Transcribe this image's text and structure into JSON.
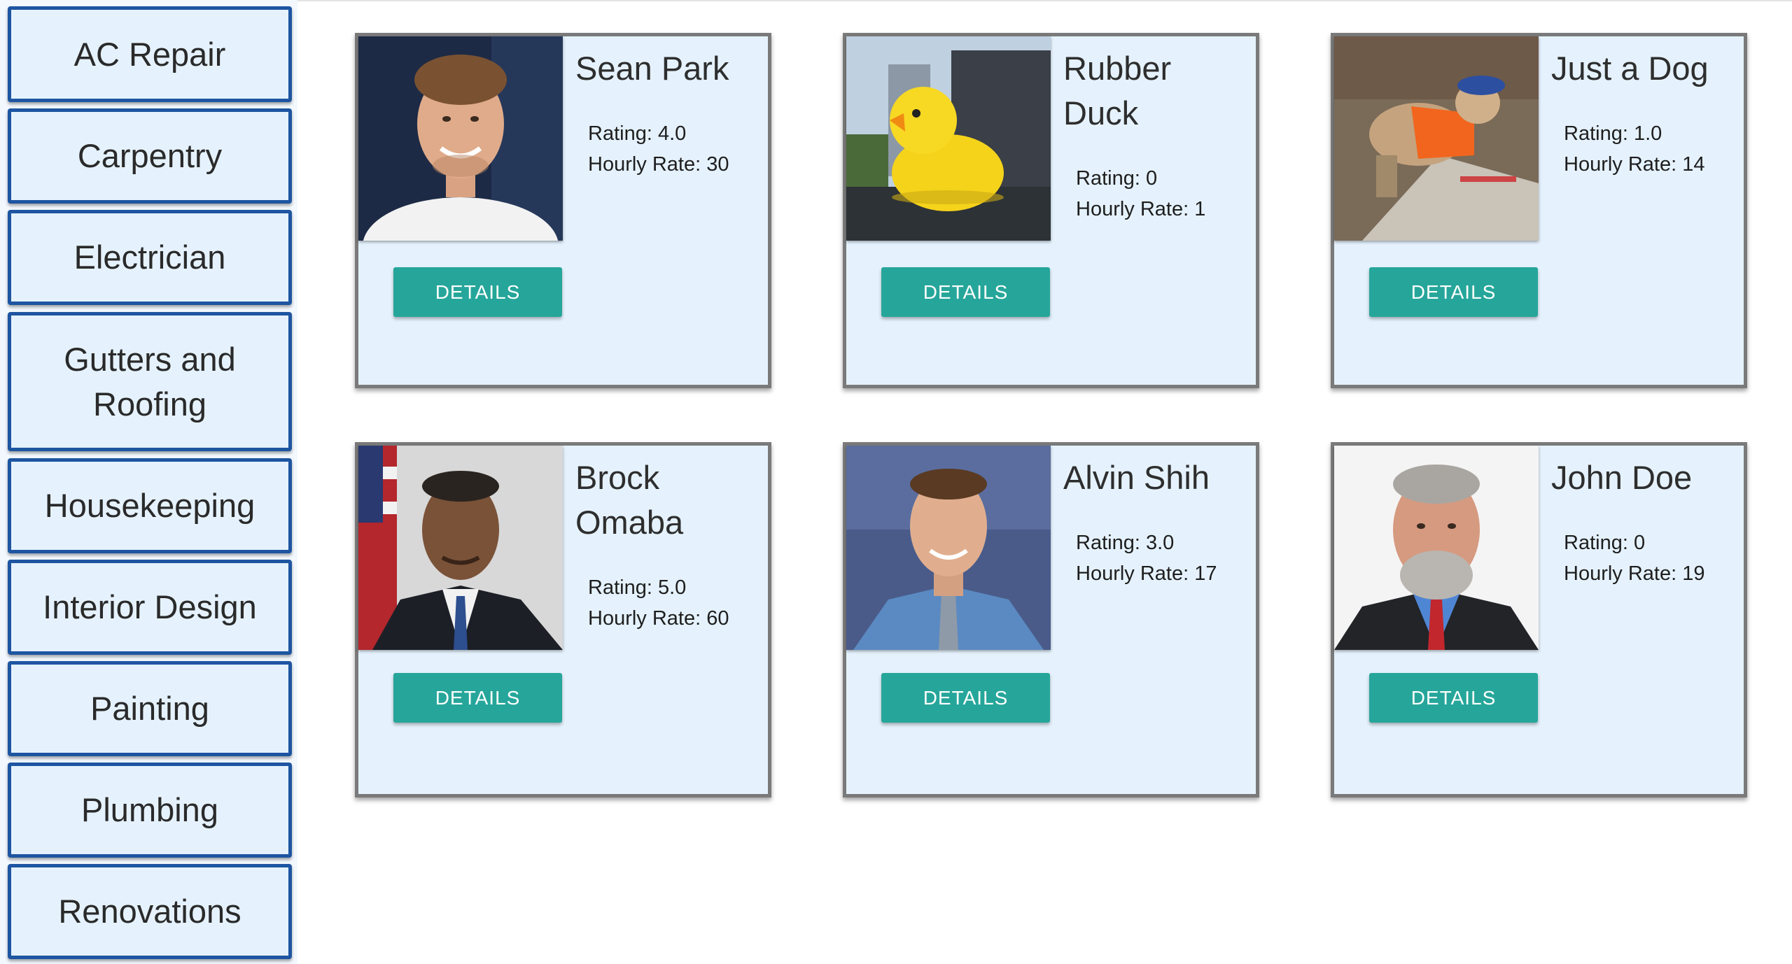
{
  "categories": [
    {
      "label": "AC Repair"
    },
    {
      "label": "Carpentry"
    },
    {
      "label": "Electrician"
    },
    {
      "label": "Gutters and Roofing"
    },
    {
      "label": "Housekeeping"
    },
    {
      "label": "Interior Design"
    },
    {
      "label": "Painting"
    },
    {
      "label": "Plumbing"
    },
    {
      "label": "Renovations"
    }
  ],
  "rating_prefix": "Rating:",
  "rate_prefix": "Hourly Rate:",
  "button_label": "DETAILS",
  "providers": [
    {
      "name": "Sean Park",
      "rating": "4.0",
      "rate": "30"
    },
    {
      "name": "Rubber Duck",
      "rating": "0",
      "rate": "1"
    },
    {
      "name": "Just a Dog",
      "rating": "1.0",
      "rate": "14"
    },
    {
      "name": "Brock Omaba",
      "rating": "5.0",
      "rate": "60"
    },
    {
      "name": "Alvin Shih",
      "rating": "3.0",
      "rate": "17"
    },
    {
      "name": "John Doe",
      "rating": "0",
      "rate": "19"
    }
  ],
  "colors": {
    "accent_button": "#26a69a",
    "category_border": "#1e55a1",
    "panel_background": "#e5f2fd"
  }
}
